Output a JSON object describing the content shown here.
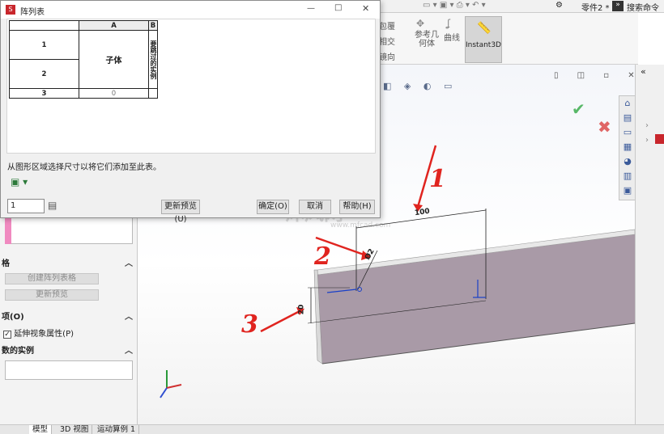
{
  "ribbon": {
    "top_items": [
      "零件2 *",
      "搜索命令"
    ],
    "tools": [
      "包覆",
      "相交",
      "镜向",
      "参考几何体",
      "曲线",
      "Instant3D"
    ]
  },
  "dialog": {
    "title": "阵列表",
    "window_buttons": [
      "—",
      "□",
      "✕"
    ],
    "table": {
      "col_headers": [
        "A",
        "B"
      ],
      "row_labels": [
        "1",
        "2",
        "3"
      ],
      "merged_cell": "子体",
      "col_b_header_text": "要跳过的实例",
      "row3_value": "0"
    },
    "hint": "从图形区域选择尺寸以将它们添加至此表。",
    "spinner_value": "1",
    "buttons": {
      "update_preview": "更新预览(U)",
      "ok": "确定(O)",
      "cancel": "取消",
      "help": "帮助(H)"
    }
  },
  "left_panel": {
    "section_table": "格",
    "create_table_btn": "创建阵列表格",
    "update_preview_btn": "更新预览",
    "section_options": "项(O)",
    "extend_visual_label": "延伸视象属性(P)",
    "extend_visual_checked": true,
    "section_instances": "数的实例"
  },
  "graphics": {
    "dim_length": "100",
    "dim_diameter": "Ø2",
    "dim_height": "20",
    "annotations": [
      "1",
      "2",
      "3"
    ],
    "watermark": "沐风网",
    "watermark_url": "www.mfcad.com"
  },
  "bottom_tabs": [
    "模型",
    "3D 视图",
    "运动算例 1"
  ],
  "colors": {
    "annotation_red": "#e0241f",
    "part_face": "#a99aa7",
    "accept_green": "#58b868",
    "reject_red": "#e06666"
  }
}
